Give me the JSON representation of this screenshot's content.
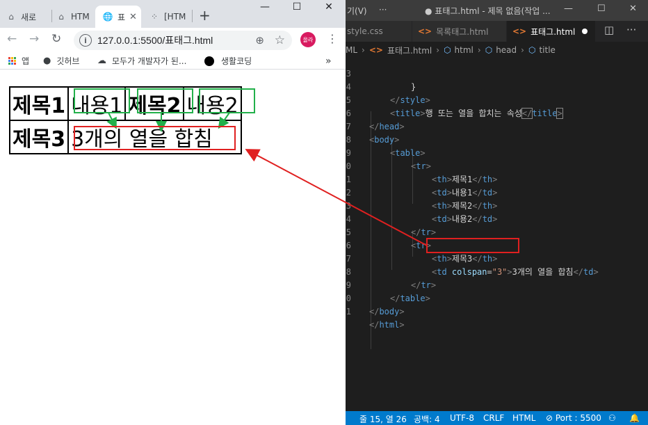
{
  "browser": {
    "tabs": [
      {
        "label": "새로",
        "icon": "home-icon"
      },
      {
        "label": "HTM",
        "icon": "home-icon"
      },
      {
        "label": "표",
        "icon": "globe-icon",
        "active": true
      },
      {
        "label": "[HTM",
        "icon": "tistory-icon"
      }
    ],
    "address": "127.0.0.1:5500/표태그.html",
    "profile_label": "올라",
    "bookmarks": [
      {
        "label": "앱",
        "icon": "apps-icon"
      },
      {
        "label": "깃허브",
        "icon": "github-icon"
      },
      {
        "label": "모두가 개발자가 된...",
        "icon": "cloud-icon"
      },
      {
        "label": "생활코딩",
        "icon": "black-circle-icon"
      }
    ],
    "page": {
      "row1": [
        "제목1",
        "내용1",
        "제목2",
        "내용2"
      ],
      "row2_head": "제목3",
      "row2_merged": "3개의 열을 합침"
    }
  },
  "vscode": {
    "title": {
      "menu": "기(V)",
      "more": "···",
      "window_title": "● 표태그.html - 제목 없음(작업 ..."
    },
    "tabs": [
      {
        "label": "style.css"
      },
      {
        "label": "목록태그.html"
      },
      {
        "label": "표태그.html",
        "active": true
      }
    ],
    "breadcrumb": [
      "ML",
      "표태그.html",
      "html",
      "head",
      "title"
    ],
    "line_numbers": [
      "3",
      "4",
      "5",
      "6",
      "7",
      "8",
      "9",
      "0",
      "1",
      "2",
      "3",
      "4",
      "5",
      "6",
      "7",
      "8",
      "9",
      "0",
      "1"
    ],
    "lines": {
      "l3": "}",
      "l5_text": "행 또는 열을 합치는 속성",
      "th1": "제목1",
      "td1": "내용1",
      "th2": "제목2",
      "td2": "내용2",
      "th3": "제목3",
      "colspan_attr": "colspan",
      "colspan_val": "\"3\"",
      "merged_text": "3개의 열을 합침"
    },
    "status": {
      "position": "줄 15, 열 26",
      "spaces": "공백: 4",
      "encoding": "UTF-8",
      "eol": "CRLF",
      "language": "HTML",
      "port": "⊘ Port : 5500"
    }
  },
  "colors": {
    "highlight_red": "#e02020",
    "highlight_green": "#22b04a",
    "vscode_status": "#007acc"
  }
}
